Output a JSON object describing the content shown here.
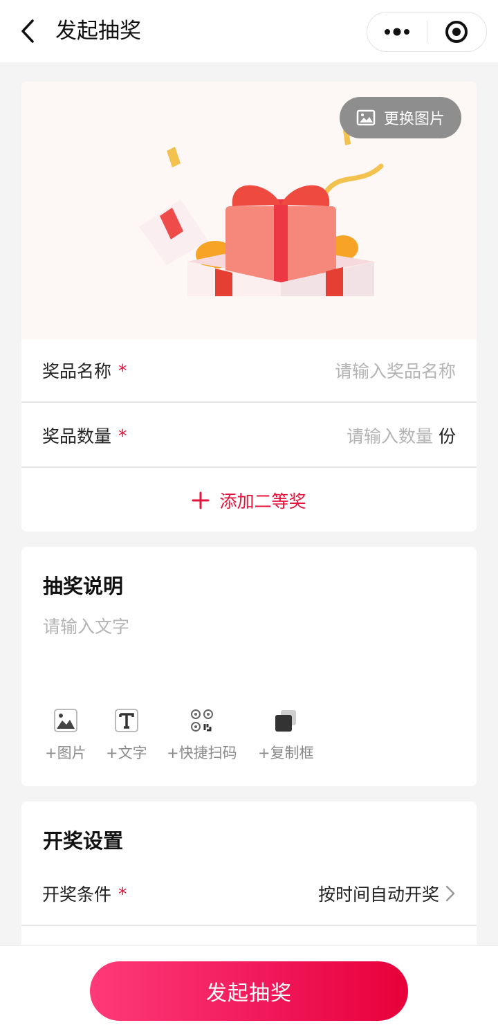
{
  "header": {
    "title": "发起抽奖"
  },
  "banner": {
    "change_image_label": "更换图片"
  },
  "prize": {
    "name_label": "奖品名称",
    "name_required": "*",
    "name_placeholder": "请输入奖品名称",
    "qty_label": "奖品数量",
    "qty_required": "*",
    "qty_placeholder": "请输入数量",
    "qty_unit": "份",
    "add_second_label": "添加二等奖"
  },
  "description": {
    "title": "抽奖说明",
    "placeholder": "请输入文字",
    "tools": [
      {
        "label": "+图片",
        "icon": "image-icon"
      },
      {
        "label": "+文字",
        "icon": "text-icon"
      },
      {
        "label": "+快捷扫码",
        "icon": "qr-icon"
      },
      {
        "label": "+复制框",
        "icon": "copy-box-icon"
      }
    ]
  },
  "draw_settings": {
    "title": "开奖设置",
    "condition_label": "开奖条件",
    "condition_required": "*",
    "condition_value": "按时间自动开奖"
  },
  "footer": {
    "submit_label": "发起抽奖"
  },
  "colors": {
    "accent": "#e5143c",
    "button_gradient_start": "#ff3a7a",
    "button_gradient_end": "#e8003a",
    "page_bg": "#f4f4f4"
  }
}
